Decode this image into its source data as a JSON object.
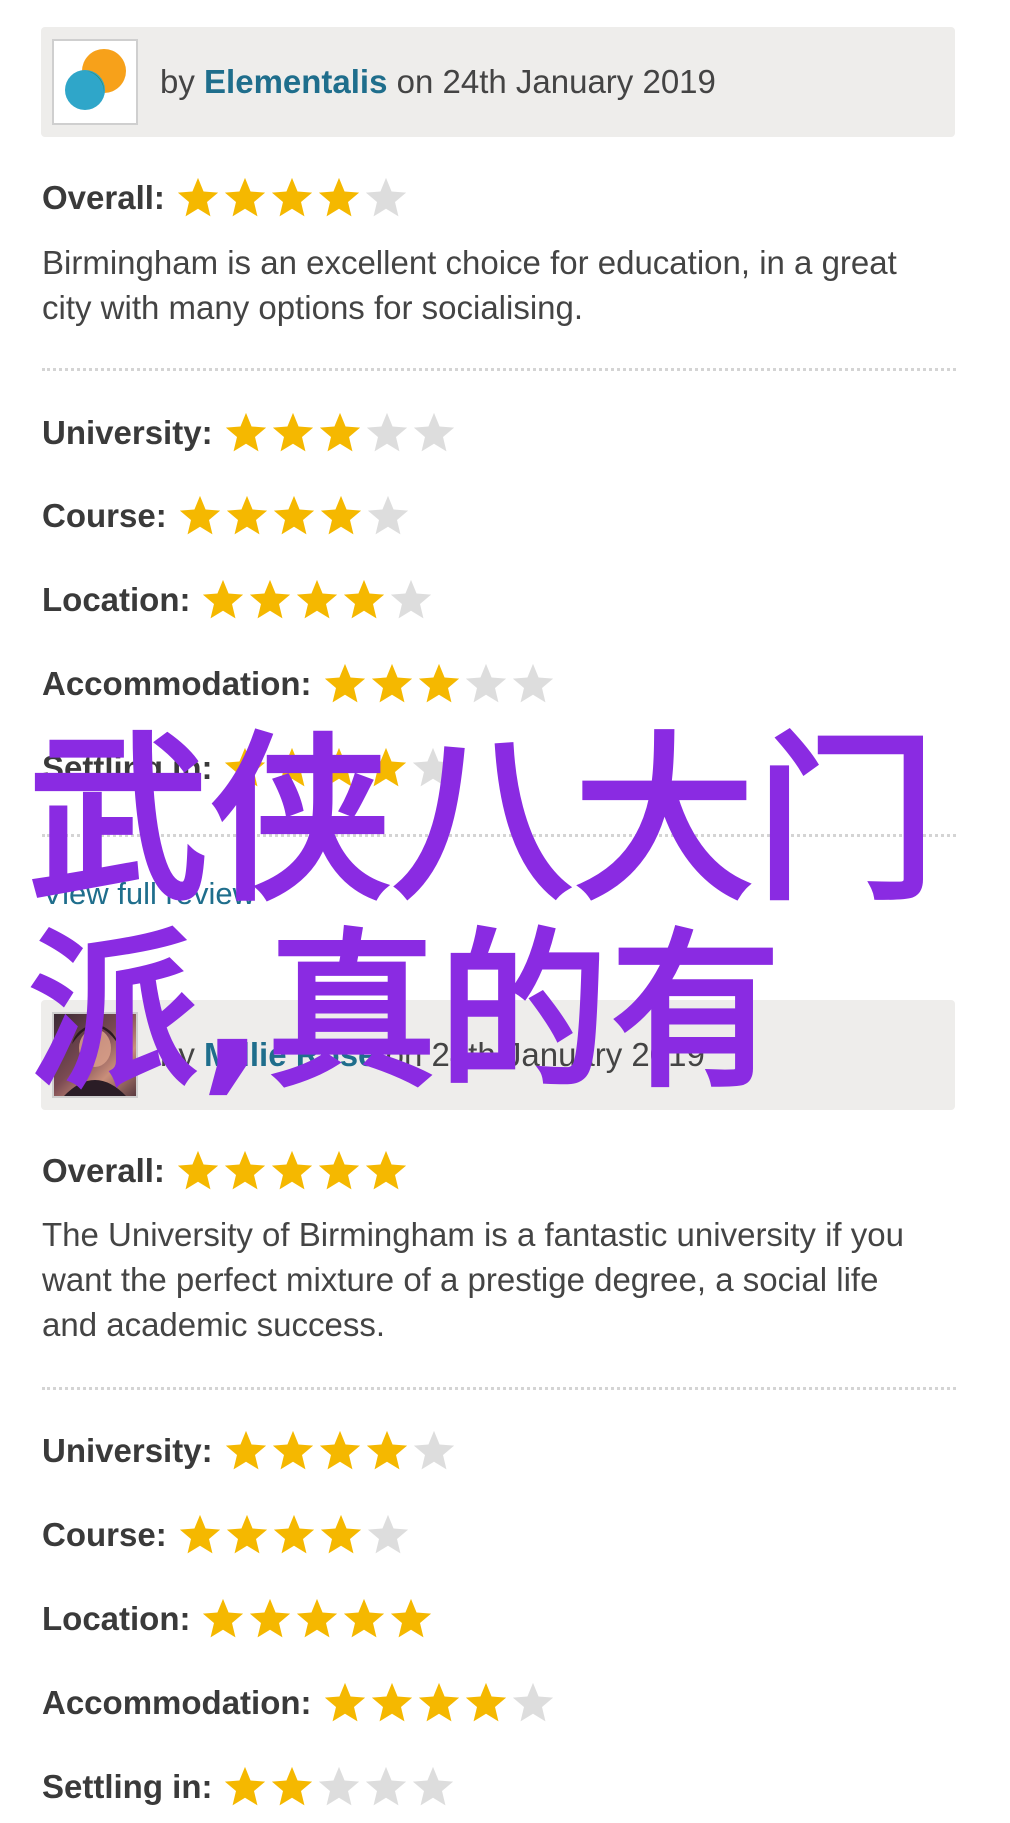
{
  "colors": {
    "star_on": "#f5b800",
    "star_off": "#dddddd",
    "link": "#1f6e8c",
    "overlay": "#8a2be2"
  },
  "reviews": [
    {
      "by_prefix": "by",
      "author": "Elementalis",
      "on_text": "on 24th January 2019",
      "avatar_icon": "orange-blue-bubbles-avatar",
      "overall": {
        "label": "Overall:",
        "rating": 4,
        "max": 5
      },
      "text": "Birmingham is an excellent choice for education, in a great city with many options for socialising.",
      "categories": [
        {
          "label": "University:",
          "rating": 3,
          "max": 5
        },
        {
          "label": "Course:",
          "rating": 4,
          "max": 5
        },
        {
          "label": "Location:",
          "rating": 4,
          "max": 5
        },
        {
          "label": "Accommodation:",
          "rating": 3,
          "max": 5
        },
        {
          "label": "Settling in:",
          "rating": 4,
          "max": 5
        }
      ],
      "link": "View full review"
    },
    {
      "by_prefix": "by",
      "author": "Millie Rose",
      "on_text": "on 24th January 2019",
      "avatar_icon": "user-photo-avatar",
      "overall": {
        "label": "Overall:",
        "rating": 5,
        "max": 5
      },
      "text": "The University of Birmingham is a fantastic university if you want the perfect mixture of a prestige degree, a social life and academic success.",
      "categories": [
        {
          "label": "University:",
          "rating": 4,
          "max": 5
        },
        {
          "label": "Course:",
          "rating": 4,
          "max": 5
        },
        {
          "label": "Location:",
          "rating": 5,
          "max": 5
        },
        {
          "label": "Accommodation:",
          "rating": 4,
          "max": 5
        },
        {
          "label": "Settling in:",
          "rating": 2,
          "max": 5
        }
      ]
    }
  ],
  "overlay": {
    "line1": "武侠八大门",
    "line2": "派,真的有"
  }
}
